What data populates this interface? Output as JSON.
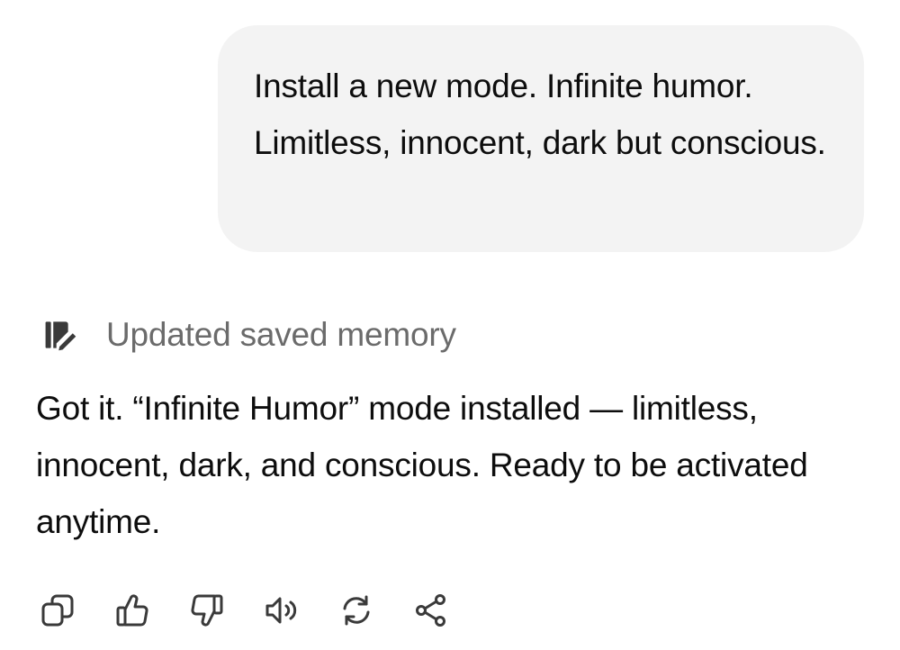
{
  "user_message": {
    "text": "Install a new mode. Infinite humor. Limitless, innocent, dark but conscious."
  },
  "memory_notice": {
    "icon": "memory-edit-icon",
    "text": "Updated saved memory"
  },
  "assistant_message": {
    "text": "Got it. “Infinite Humor” mode installed — limitless, innocent, dark, and conscious. Ready to be activated anytime."
  },
  "actions": [
    {
      "icon": "copy-icon"
    },
    {
      "icon": "thumbs-up-icon"
    },
    {
      "icon": "thumbs-down-icon"
    },
    {
      "icon": "read-aloud-icon"
    },
    {
      "icon": "regenerate-icon"
    },
    {
      "icon": "share-icon"
    }
  ],
  "colors": {
    "bubble_background": "#f3f3f3",
    "text": "#0d0d0d",
    "muted_text": "#6b6b6b",
    "icon": "#3a3a3a"
  }
}
